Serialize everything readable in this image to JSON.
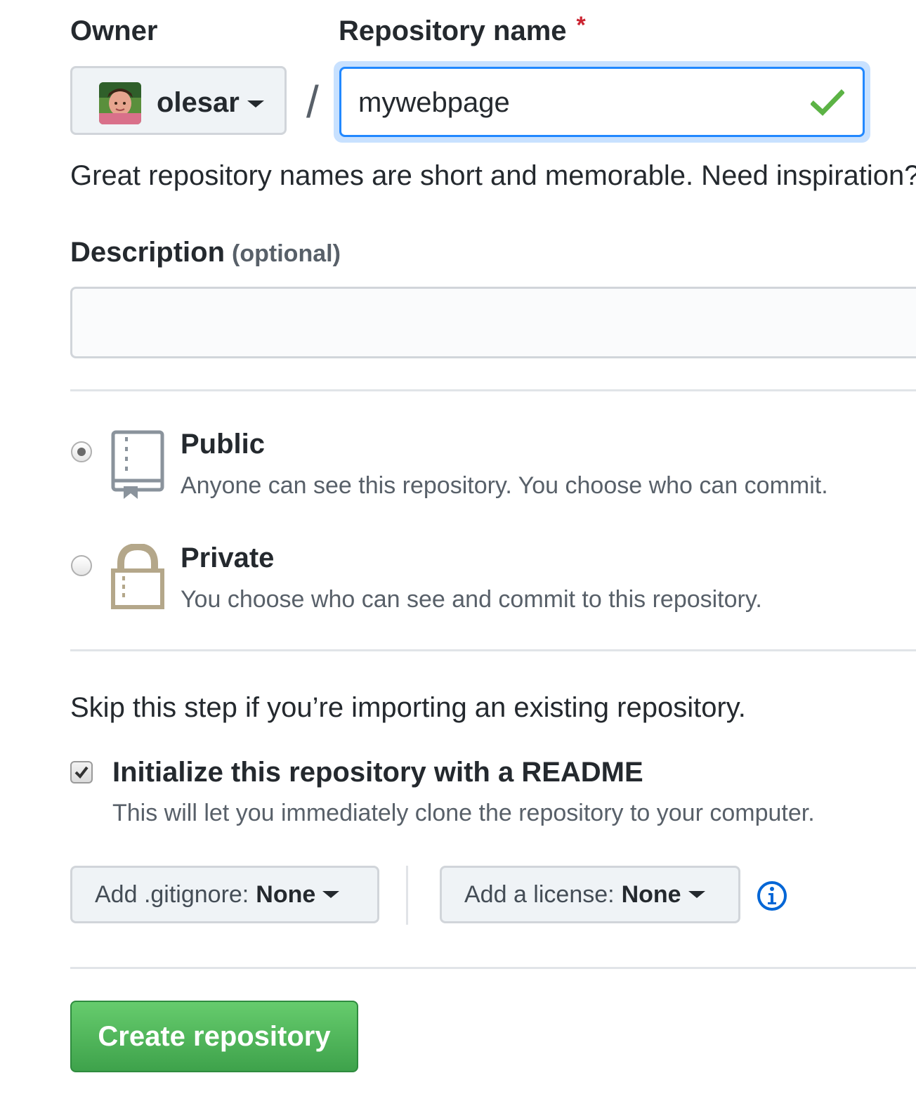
{
  "owner": {
    "label": "Owner",
    "selected": "olesar",
    "avatar_icon": "user-avatar"
  },
  "repository": {
    "label": "Repository name",
    "required_marker": "*",
    "separator": "/",
    "value": "mywebpage",
    "valid_icon": "check-icon"
  },
  "hint": "Great repository names are short and memorable. Need inspiration?",
  "description": {
    "label": "Description",
    "optional_label": "(optional)",
    "value": ""
  },
  "visibility": {
    "options": [
      {
        "title": "Public",
        "description": "Anyone can see this repository. You choose who can commit.",
        "icon": "repo-book-icon",
        "selected": true
      },
      {
        "title": "Private",
        "description": "You choose who can see and commit to this repository.",
        "icon": "lock-icon",
        "selected": false
      }
    ]
  },
  "init": {
    "skip_text": "Skip this step if you’re importing an existing repository.",
    "readme_label": "Initialize this repository with a README",
    "readme_desc": "This will let you immediately clone the repository to your computer.",
    "readme_checked": true
  },
  "gitignore": {
    "prefix": "Add .gitignore:",
    "value": "None"
  },
  "license": {
    "prefix": "Add a license:",
    "value": "None"
  },
  "info_icon": "info-icon",
  "create_button": "Create repository",
  "colors": {
    "focus_border": "#2188ff",
    "success_green": "#28a745",
    "required_red": "#cb2431",
    "info_blue": "#0366d6"
  }
}
